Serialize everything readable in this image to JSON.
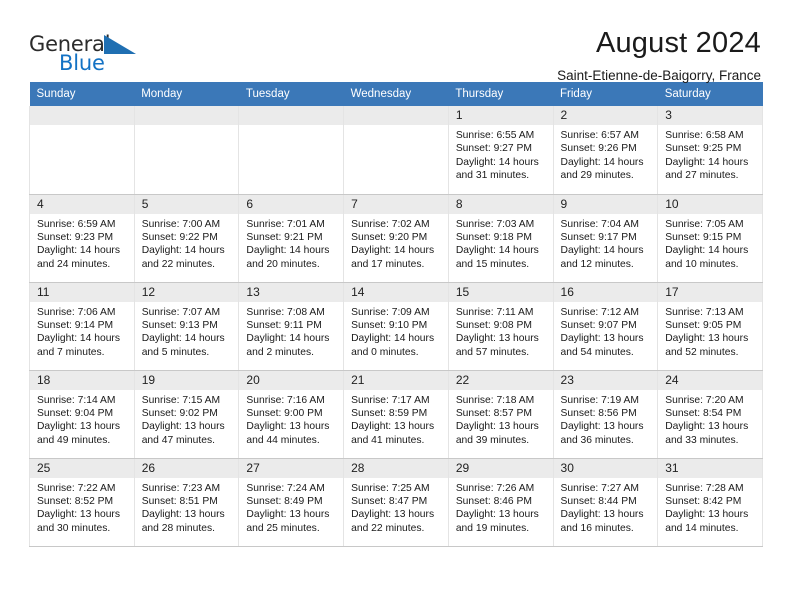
{
  "logo": {
    "word_one": "General",
    "word_two": "Blue",
    "triangle_icon": "blue-triangle-icon"
  },
  "header": {
    "title": "August 2024",
    "subtitle": "Saint-Etienne-de-Baigorry, France"
  },
  "theme": {
    "header_blue": "#3b78b8",
    "daynum_gray": "#ebebeb",
    "logo_blue": "#1372c4",
    "text": "#1a1a1a"
  },
  "calendar": {
    "weekday_headers": [
      "Sunday",
      "Monday",
      "Tuesday",
      "Wednesday",
      "Thursday",
      "Friday",
      "Saturday"
    ],
    "labels": {
      "sunrise": "Sunrise:",
      "sunset": "Sunset:",
      "daylight": "Daylight:"
    },
    "weeks": [
      [
        {
          "day": "",
          "blank": true
        },
        {
          "day": "",
          "blank": true
        },
        {
          "day": "",
          "blank": true
        },
        {
          "day": "",
          "blank": true
        },
        {
          "day": "1",
          "sunrise": "Sunrise: 6:55 AM",
          "sunset": "Sunset: 9:27 PM",
          "daylight_1": "Daylight: 14 hours",
          "daylight_2": "and 31 minutes."
        },
        {
          "day": "2",
          "sunrise": "Sunrise: 6:57 AM",
          "sunset": "Sunset: 9:26 PM",
          "daylight_1": "Daylight: 14 hours",
          "daylight_2": "and 29 minutes."
        },
        {
          "day": "3",
          "sunrise": "Sunrise: 6:58 AM",
          "sunset": "Sunset: 9:25 PM",
          "daylight_1": "Daylight: 14 hours",
          "daylight_2": "and 27 minutes."
        }
      ],
      [
        {
          "day": "4",
          "sunrise": "Sunrise: 6:59 AM",
          "sunset": "Sunset: 9:23 PM",
          "daylight_1": "Daylight: 14 hours",
          "daylight_2": "and 24 minutes."
        },
        {
          "day": "5",
          "sunrise": "Sunrise: 7:00 AM",
          "sunset": "Sunset: 9:22 PM",
          "daylight_1": "Daylight: 14 hours",
          "daylight_2": "and 22 minutes."
        },
        {
          "day": "6",
          "sunrise": "Sunrise: 7:01 AM",
          "sunset": "Sunset: 9:21 PM",
          "daylight_1": "Daylight: 14 hours",
          "daylight_2": "and 20 minutes."
        },
        {
          "day": "7",
          "sunrise": "Sunrise: 7:02 AM",
          "sunset": "Sunset: 9:20 PM",
          "daylight_1": "Daylight: 14 hours",
          "daylight_2": "and 17 minutes."
        },
        {
          "day": "8",
          "sunrise": "Sunrise: 7:03 AM",
          "sunset": "Sunset: 9:18 PM",
          "daylight_1": "Daylight: 14 hours",
          "daylight_2": "and 15 minutes."
        },
        {
          "day": "9",
          "sunrise": "Sunrise: 7:04 AM",
          "sunset": "Sunset: 9:17 PM",
          "daylight_1": "Daylight: 14 hours",
          "daylight_2": "and 12 minutes."
        },
        {
          "day": "10",
          "sunrise": "Sunrise: 7:05 AM",
          "sunset": "Sunset: 9:15 PM",
          "daylight_1": "Daylight: 14 hours",
          "daylight_2": "and 10 minutes."
        }
      ],
      [
        {
          "day": "11",
          "sunrise": "Sunrise: 7:06 AM",
          "sunset": "Sunset: 9:14 PM",
          "daylight_1": "Daylight: 14 hours",
          "daylight_2": "and 7 minutes."
        },
        {
          "day": "12",
          "sunrise": "Sunrise: 7:07 AM",
          "sunset": "Sunset: 9:13 PM",
          "daylight_1": "Daylight: 14 hours",
          "daylight_2": "and 5 minutes."
        },
        {
          "day": "13",
          "sunrise": "Sunrise: 7:08 AM",
          "sunset": "Sunset: 9:11 PM",
          "daylight_1": "Daylight: 14 hours",
          "daylight_2": "and 2 minutes."
        },
        {
          "day": "14",
          "sunrise": "Sunrise: 7:09 AM",
          "sunset": "Sunset: 9:10 PM",
          "daylight_1": "Daylight: 14 hours",
          "daylight_2": "and 0 minutes."
        },
        {
          "day": "15",
          "sunrise": "Sunrise: 7:11 AM",
          "sunset": "Sunset: 9:08 PM",
          "daylight_1": "Daylight: 13 hours",
          "daylight_2": "and 57 minutes."
        },
        {
          "day": "16",
          "sunrise": "Sunrise: 7:12 AM",
          "sunset": "Sunset: 9:07 PM",
          "daylight_1": "Daylight: 13 hours",
          "daylight_2": "and 54 minutes."
        },
        {
          "day": "17",
          "sunrise": "Sunrise: 7:13 AM",
          "sunset": "Sunset: 9:05 PM",
          "daylight_1": "Daylight: 13 hours",
          "daylight_2": "and 52 minutes."
        }
      ],
      [
        {
          "day": "18",
          "sunrise": "Sunrise: 7:14 AM",
          "sunset": "Sunset: 9:04 PM",
          "daylight_1": "Daylight: 13 hours",
          "daylight_2": "and 49 minutes."
        },
        {
          "day": "19",
          "sunrise": "Sunrise: 7:15 AM",
          "sunset": "Sunset: 9:02 PM",
          "daylight_1": "Daylight: 13 hours",
          "daylight_2": "and 47 minutes."
        },
        {
          "day": "20",
          "sunrise": "Sunrise: 7:16 AM",
          "sunset": "Sunset: 9:00 PM",
          "daylight_1": "Daylight: 13 hours",
          "daylight_2": "and 44 minutes."
        },
        {
          "day": "21",
          "sunrise": "Sunrise: 7:17 AM",
          "sunset": "Sunset: 8:59 PM",
          "daylight_1": "Daylight: 13 hours",
          "daylight_2": "and 41 minutes."
        },
        {
          "day": "22",
          "sunrise": "Sunrise: 7:18 AM",
          "sunset": "Sunset: 8:57 PM",
          "daylight_1": "Daylight: 13 hours",
          "daylight_2": "and 39 minutes."
        },
        {
          "day": "23",
          "sunrise": "Sunrise: 7:19 AM",
          "sunset": "Sunset: 8:56 PM",
          "daylight_1": "Daylight: 13 hours",
          "daylight_2": "and 36 minutes."
        },
        {
          "day": "24",
          "sunrise": "Sunrise: 7:20 AM",
          "sunset": "Sunset: 8:54 PM",
          "daylight_1": "Daylight: 13 hours",
          "daylight_2": "and 33 minutes."
        }
      ],
      [
        {
          "day": "25",
          "sunrise": "Sunrise: 7:22 AM",
          "sunset": "Sunset: 8:52 PM",
          "daylight_1": "Daylight: 13 hours",
          "daylight_2": "and 30 minutes."
        },
        {
          "day": "26",
          "sunrise": "Sunrise: 7:23 AM",
          "sunset": "Sunset: 8:51 PM",
          "daylight_1": "Daylight: 13 hours",
          "daylight_2": "and 28 minutes."
        },
        {
          "day": "27",
          "sunrise": "Sunrise: 7:24 AM",
          "sunset": "Sunset: 8:49 PM",
          "daylight_1": "Daylight: 13 hours",
          "daylight_2": "and 25 minutes."
        },
        {
          "day": "28",
          "sunrise": "Sunrise: 7:25 AM",
          "sunset": "Sunset: 8:47 PM",
          "daylight_1": "Daylight: 13 hours",
          "daylight_2": "and 22 minutes."
        },
        {
          "day": "29",
          "sunrise": "Sunrise: 7:26 AM",
          "sunset": "Sunset: 8:46 PM",
          "daylight_1": "Daylight: 13 hours",
          "daylight_2": "and 19 minutes."
        },
        {
          "day": "30",
          "sunrise": "Sunrise: 7:27 AM",
          "sunset": "Sunset: 8:44 PM",
          "daylight_1": "Daylight: 13 hours",
          "daylight_2": "and 16 minutes."
        },
        {
          "day": "31",
          "sunrise": "Sunrise: 7:28 AM",
          "sunset": "Sunset: 8:42 PM",
          "daylight_1": "Daylight: 13 hours",
          "daylight_2": "and 14 minutes."
        }
      ]
    ]
  }
}
